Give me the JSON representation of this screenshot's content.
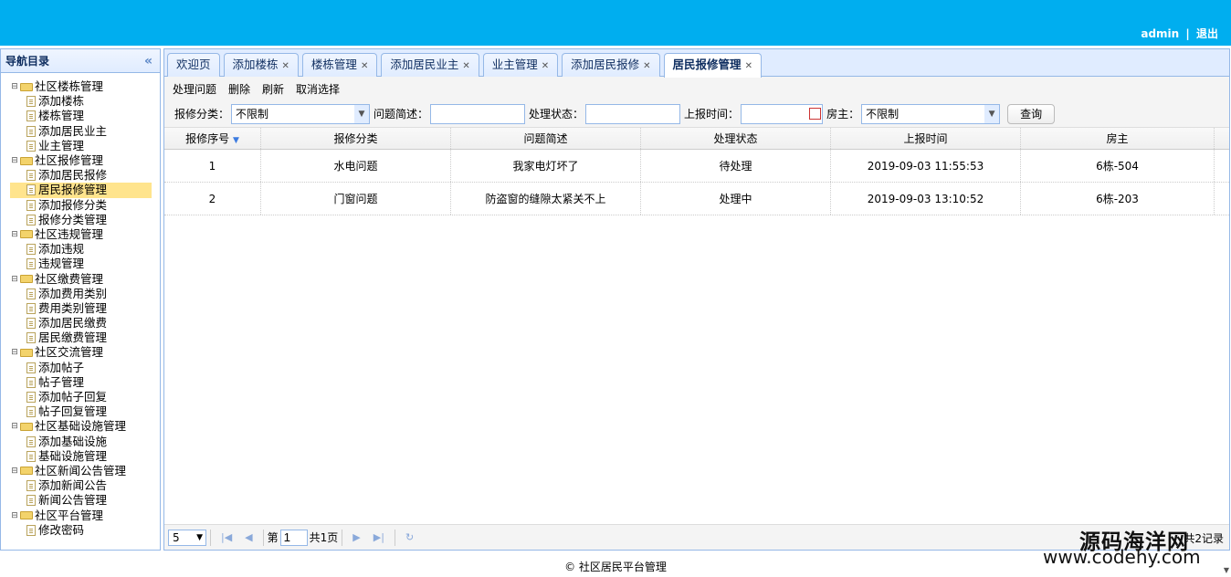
{
  "header": {
    "user": "admin",
    "separator": "|",
    "logout": "退出"
  },
  "nav": {
    "title": "导航目录",
    "collapse": "«",
    "tree": [
      {
        "label": "社区楼栋管理",
        "children": [
          "添加楼栋",
          "楼栋管理",
          "添加居民业主",
          "业主管理"
        ]
      },
      {
        "label": "社区报修管理",
        "children": [
          "添加居民报修",
          "居民报修管理",
          "添加报修分类",
          "报修分类管理"
        ]
      },
      {
        "label": "社区违规管理",
        "children": [
          "添加违规",
          "违规管理"
        ]
      },
      {
        "label": "社区缴费管理",
        "children": [
          "添加费用类别",
          "费用类别管理",
          "添加居民缴费",
          "居民缴费管理"
        ]
      },
      {
        "label": "社区交流管理",
        "children": [
          "添加帖子",
          "帖子管理",
          "添加帖子回复",
          "帖子回复管理"
        ]
      },
      {
        "label": "社区基础设施管理",
        "children": [
          "添加基础设施",
          "基础设施管理"
        ]
      },
      {
        "label": "社区新闻公告管理",
        "children": [
          "添加新闻公告",
          "新闻公告管理"
        ]
      },
      {
        "label": "社区平台管理",
        "children": [
          "修改密码"
        ]
      }
    ],
    "selected": "居民报修管理"
  },
  "tabs": [
    {
      "label": "欢迎页",
      "closable": false
    },
    {
      "label": "添加楼栋",
      "closable": true
    },
    {
      "label": "楼栋管理",
      "closable": true
    },
    {
      "label": "添加居民业主",
      "closable": true
    },
    {
      "label": "业主管理",
      "closable": true
    },
    {
      "label": "添加居民报修",
      "closable": true
    },
    {
      "label": "居民报修管理",
      "closable": true,
      "active": true
    }
  ],
  "toolbar": {
    "handle": "处理问题",
    "delete": "删除",
    "refresh": "刷新",
    "cancel": "取消选择"
  },
  "search": {
    "category_label": "报修分类：",
    "category_value": "不限制",
    "desc_label": "问题简述：",
    "desc_value": "",
    "status_label": "处理状态：",
    "status_value": "",
    "time_label": "上报时间：",
    "time_value": "",
    "owner_label": "房主：",
    "owner_value": "不限制",
    "query_button": "查询"
  },
  "grid": {
    "columns": [
      "报修序号",
      "报修分类",
      "问题简述",
      "处理状态",
      "上报时间",
      "房主"
    ],
    "sort_icon": "▼",
    "rows": [
      [
        "1",
        "水电问题",
        "我家电灯坏了",
        "待处理",
        "2019-09-03 11:55:53",
        "6栋-504"
      ],
      [
        "2",
        "门窗问题",
        "防盗窗的缝隙太紧关不上",
        "处理中",
        "2019-09-03 13:10:52",
        "6栋-203"
      ]
    ]
  },
  "pager": {
    "page_size": "5",
    "page_label": "第",
    "page_value": "1",
    "total_pages": "共1页",
    "records": "共2记录"
  },
  "footer": "© 社区居民平台管理",
  "watermark": {
    "line1": "源码海洋网",
    "line2": "www.codehy.com"
  },
  "colors": {
    "topbar": "#00AEEF",
    "border": "#95B8E7",
    "selected": "#FFE48D"
  }
}
